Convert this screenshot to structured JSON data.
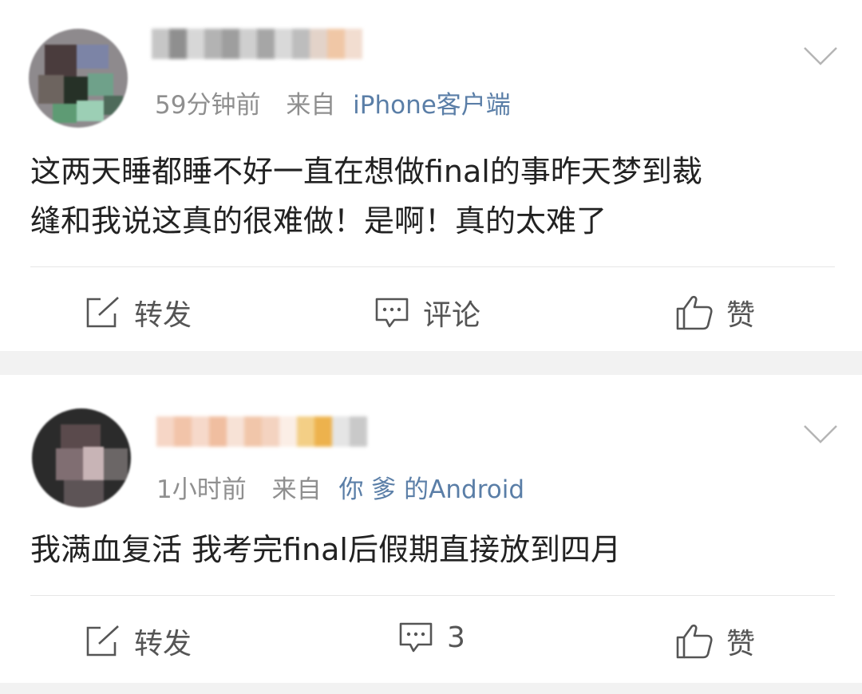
{
  "posts": [
    {
      "time": "59分钟前",
      "from_label": "来自",
      "source": "iPhone客户端",
      "text": "这两天睡都睡不好一直在想做final的事昨天梦到裁\n缝和我说这真的很难做！是啊！真的太难了",
      "actions": {
        "repost": "转发",
        "comment": "评论",
        "like": "赞"
      }
    },
    {
      "time": "1小时前",
      "from_label": "来自",
      "source": "你 爹 的Android",
      "text": "我满血复活 我考完final后假期直接放到四月",
      "actions": {
        "repost": "转发",
        "comment": "3",
        "like": "赞"
      }
    }
  ],
  "icons": {
    "repost": "repost-icon",
    "comment": "comment-icon",
    "like": "like-icon",
    "more": "chevron-down-icon",
    "avatar": "user-avatar"
  },
  "colors": {
    "source_link": "#5a7ea7",
    "meta_gray": "#8f8f8f",
    "text": "#222222",
    "page_bg": "#f2f2f2"
  }
}
